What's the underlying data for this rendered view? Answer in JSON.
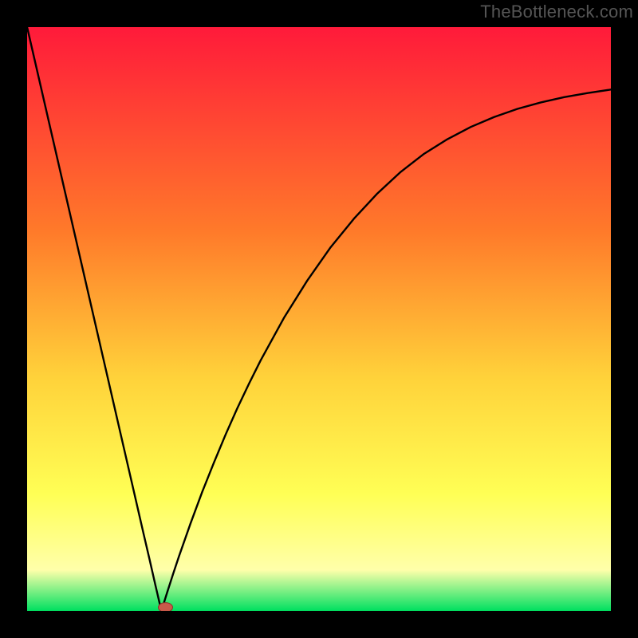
{
  "watermark": "TheBottleneck.com",
  "colors": {
    "frame": "#000000",
    "curve": "#000000",
    "marker_fill": "#c95a4a",
    "marker_stroke": "#8a332a",
    "gradient_top": "#ff1a3a",
    "gradient_mid1": "#ff7a2a",
    "gradient_mid2": "#ffd23a",
    "gradient_mid3": "#ffff55",
    "gradient_mid4": "#ffffaa",
    "gradient_bottom": "#00e060"
  },
  "chart_data": {
    "type": "line",
    "title": "",
    "xlabel": "",
    "ylabel": "",
    "xlim": [
      0,
      100
    ],
    "ylim": [
      0,
      100
    ],
    "optimum_x": 23,
    "x": [
      0,
      2,
      4,
      6,
      8,
      10,
      12,
      14,
      16,
      18,
      20,
      21,
      22,
      23,
      24,
      25,
      26,
      28,
      30,
      32,
      34,
      36,
      38,
      40,
      44,
      48,
      52,
      56,
      60,
      64,
      68,
      72,
      76,
      80,
      84,
      88,
      92,
      96,
      100
    ],
    "y": [
      100,
      91.3,
      82.6,
      73.9,
      65.2,
      56.5,
      47.8,
      39.1,
      30.4,
      21.7,
      13.0,
      8.7,
      4.3,
      0.0,
      3.2,
      6.3,
      9.3,
      15.0,
      20.4,
      25.4,
      30.2,
      34.7,
      38.9,
      42.9,
      50.2,
      56.6,
      62.3,
      67.2,
      71.5,
      75.2,
      78.3,
      80.8,
      82.9,
      84.6,
      86.0,
      87.1,
      88.0,
      88.7,
      89.3
    ],
    "marker": {
      "x": 23.7,
      "y": 0.6
    }
  }
}
